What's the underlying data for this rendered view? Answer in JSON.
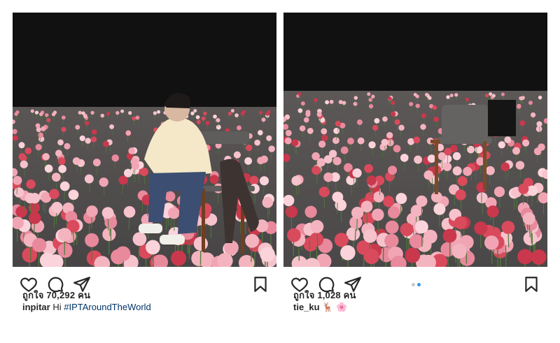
{
  "posts": [
    {
      "likes_text": "ถูกใจ 70,292 คน",
      "username": "inpitar",
      "caption_text": "Hi",
      "hashtag": "#IPTAroundTheWorld"
    },
    {
      "likes_text": "ถูกใจ 1,028 คน",
      "username": "tie_ku",
      "caption_text": "🦌 🌸",
      "hashtag": ""
    }
  ],
  "colors": {
    "accent": "#3897f0",
    "text": "#262626",
    "hashtag": "#003569"
  },
  "icons": {
    "like": "heart-icon",
    "comment": "comment-icon",
    "share": "share-icon",
    "save": "bookmark-icon"
  }
}
